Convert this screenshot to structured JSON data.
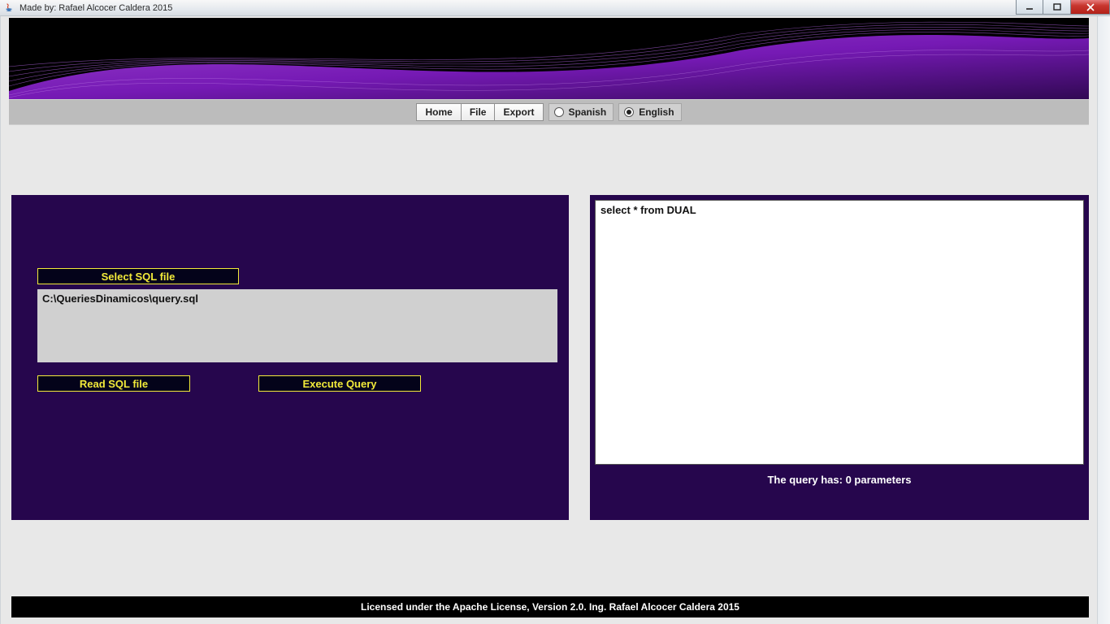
{
  "window": {
    "title": "Made by: Rafael Alcocer Caldera 2015"
  },
  "menu": {
    "home": "Home",
    "file": "File",
    "export": "Export",
    "lang_spanish": "Spanish",
    "lang_english": "English",
    "selected_language": "english"
  },
  "left_panel": {
    "select_sql_label": "Select SQL file",
    "file_path": "C:\\QueriesDinamicos\\query.sql",
    "read_sql_label": "Read SQL file",
    "execute_query_label": "Execute Query"
  },
  "right_panel": {
    "query_text": "select * from DUAL",
    "parameters_label": "The query has: 0 parameters"
  },
  "footer": {
    "text": "Licensed under the Apache License, Version 2.0. Ing. Rafael Alcocer Caldera 2015"
  }
}
